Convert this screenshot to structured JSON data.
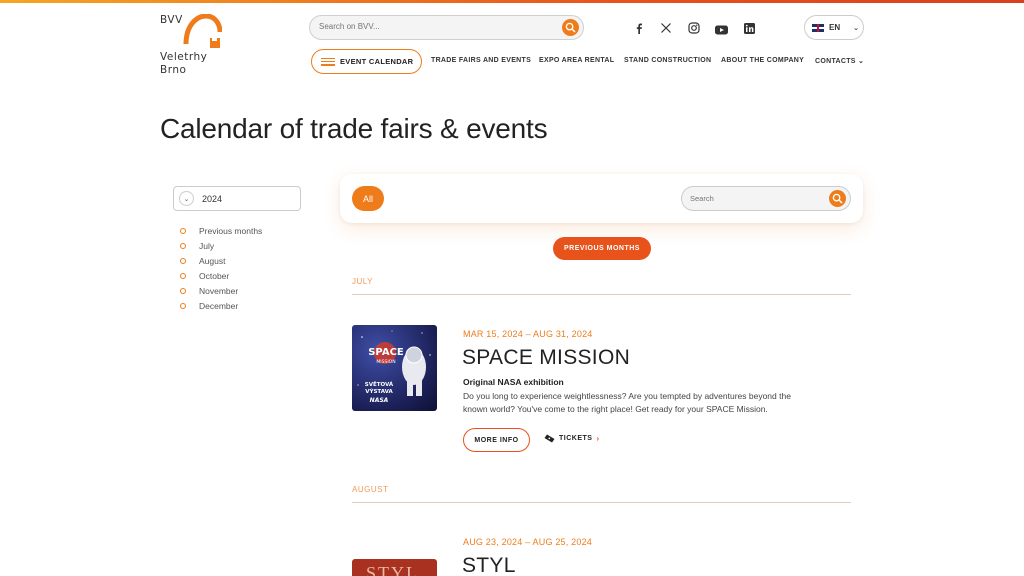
{
  "logo": {
    "line0": "BVV",
    "line1": "Veletrhy",
    "line2": "Brno"
  },
  "search": {
    "placeholder": "Search on BVV..."
  },
  "social": [
    "facebook-icon",
    "x-icon",
    "instagram-icon",
    "youtube-icon",
    "linkedin-icon"
  ],
  "lang": {
    "label": "EN"
  },
  "nav": {
    "event_calendar": "EVENT CALENDAR",
    "items": [
      "TRADE FAIRS AND EVENTS",
      "EXPO AREA RENTAL",
      "STAND CONSTRUCTION",
      "ABOUT THE COMPANY",
      "CONTACTS"
    ]
  },
  "page": {
    "title": "Calendar of trade fairs & events"
  },
  "sidebar": {
    "year": "2024",
    "months": [
      "Previous months",
      "July",
      "August",
      "October",
      "November",
      "December"
    ]
  },
  "filter": {
    "all_label": "All",
    "search_placeholder": "Search"
  },
  "previous_months_label": "PREVIOUS MONTHS",
  "sections": [
    {
      "label": "JULY",
      "event": {
        "date": "MAR 15, 2024 – AUG 31, 2024",
        "title": "SPACE MISSION",
        "subtitle": "Original NASA exhibition",
        "description": "Do you long to experience weightlessness? Are you tempted by adventures beyond the known world? You've come to the right place! Get ready for your SPACE Mission.",
        "more_label": "MORE INFO",
        "tickets_label": "TICKETS",
        "image_text": [
          "SPACE",
          "MISSION",
          "SVĚTOVÁ",
          "VÝSTAVA",
          "NASA"
        ]
      }
    },
    {
      "label": "AUGUST",
      "event": {
        "date": "AUG 23, 2024 – AUG 25, 2024",
        "title": "STYL",
        "image_text": "STYL"
      }
    }
  ],
  "colors": {
    "accent": "#ee7c1b",
    "accent_dark": "#e8521b"
  }
}
